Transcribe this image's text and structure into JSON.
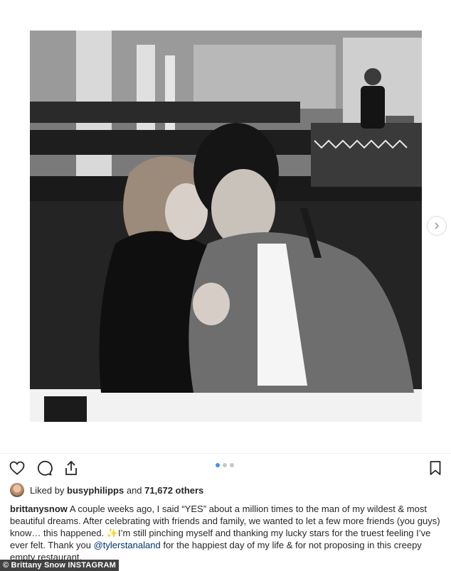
{
  "post": {
    "photo_alt": "",
    "carousel": {
      "count": 3,
      "active": 0
    }
  },
  "actions": {
    "like_icon": "heart-icon",
    "comment_icon": "comment-icon",
    "share_icon": "share-icon",
    "save_icon": "bookmark-icon"
  },
  "likes": {
    "prefix": "Liked by",
    "user": "busyphilipps",
    "joiner": "and",
    "count": "71,672 others"
  },
  "caption": {
    "username": "brittanysnow",
    "text_1": "A couple weeks ago, I said “YES” about a million times to the man of my wildest & most beautiful dreams. After celebrating with friends and family, we wanted to let a few more friends (you guys) know… this happened. ✨I’m still pinching myself and thanking my lucky stars for the truest feeling I’ve ever felt. Thank you",
    "mention": "@tylerstanaland",
    "text_2": "for the happiest day of my life & for not proposing in this creepy empty restaurant."
  },
  "credit": "© Brittany Snow INSTAGRAM",
  "colors": {
    "accent": "#3897f0",
    "text": "#262626",
    "mention": "#003569"
  }
}
